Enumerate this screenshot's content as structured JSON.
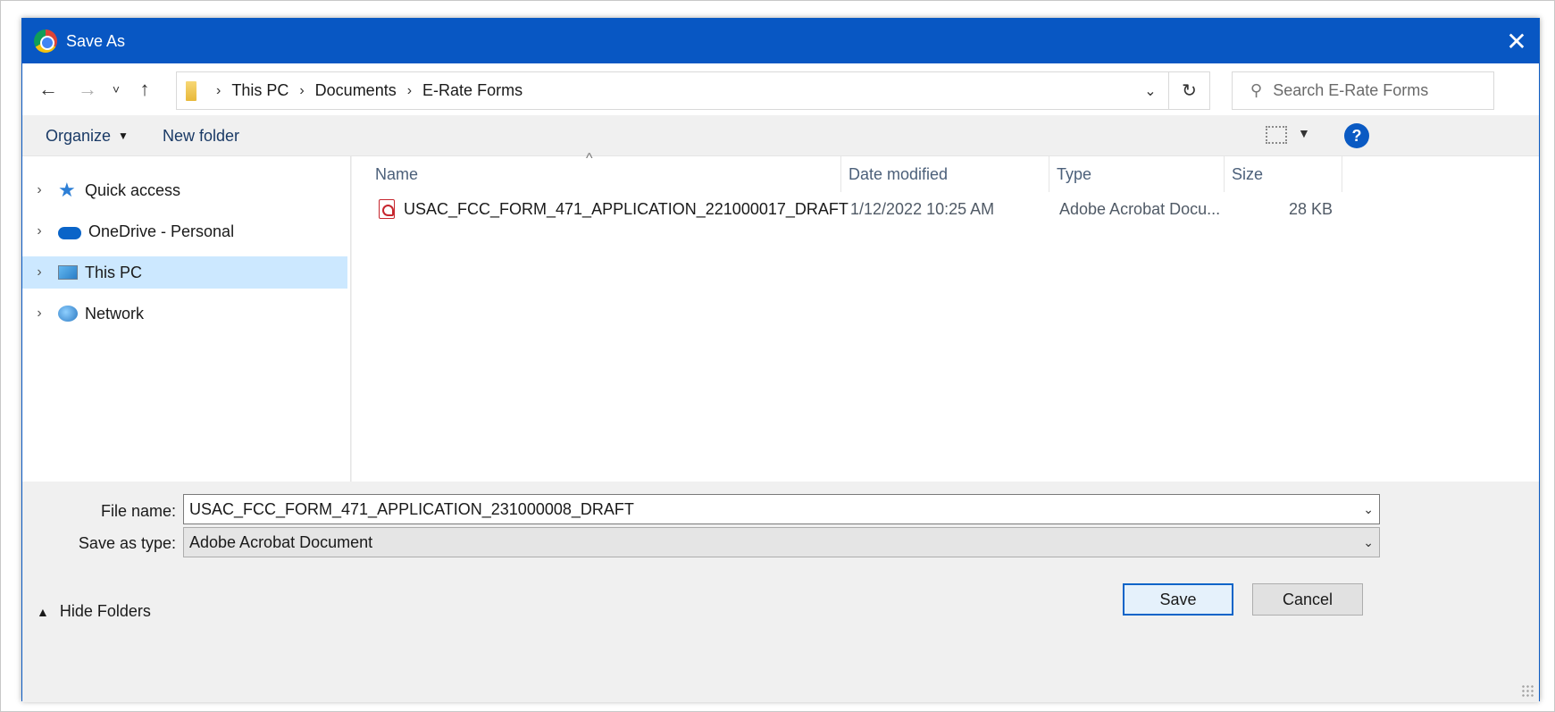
{
  "window": {
    "title": "Save As",
    "close_glyph": "✕"
  },
  "nav": {
    "back_glyph": "←",
    "forward_glyph": "→",
    "recent_glyph": "˅",
    "up_glyph": "↑",
    "breadcrumbs": [
      "This PC",
      "Documents",
      "E-Rate Forms"
    ],
    "breadcrumb_sep": "›",
    "dropdown_glyph": "⌄",
    "refresh_glyph": "↻",
    "search_placeholder": "Search E-Rate Forms"
  },
  "toolbar": {
    "organize_label": "Organize",
    "new_folder_label": "New folder",
    "help_glyph": "?"
  },
  "sidebar": {
    "items": [
      {
        "label": "Quick access",
        "icon": "star-icon",
        "selected": false
      },
      {
        "label": "OneDrive - Personal",
        "icon": "cloud-icon",
        "selected": false
      },
      {
        "label": "This PC",
        "icon": "computer-icon",
        "selected": true
      },
      {
        "label": "Network",
        "icon": "network-icon",
        "selected": false
      }
    ]
  },
  "file_list": {
    "columns": [
      "Name",
      "Date modified",
      "Type",
      "Size"
    ],
    "sort_glyph": "^",
    "rows": [
      {
        "icon": "pdf-icon",
        "name": "USAC_FCC_FORM_471_APPLICATION_221000017_DRAFT",
        "date_modified": "1/12/2022 10:25 AM",
        "type": "Adobe Acrobat Docu...",
        "size": "28 KB"
      }
    ]
  },
  "form": {
    "file_name_label": "File name:",
    "file_name_value": "USAC_FCC_FORM_471_APPLICATION_231000008_DRAFT",
    "save_type_label": "Save as type:",
    "save_type_value": "Adobe Acrobat Document"
  },
  "footer": {
    "hide_folders_label": "Hide Folders",
    "save_label": "Save",
    "cancel_label": "Cancel"
  },
  "colors": {
    "titlebar": "#0857c3",
    "selection": "#cce8ff",
    "primary_border": "#0a64c8"
  }
}
